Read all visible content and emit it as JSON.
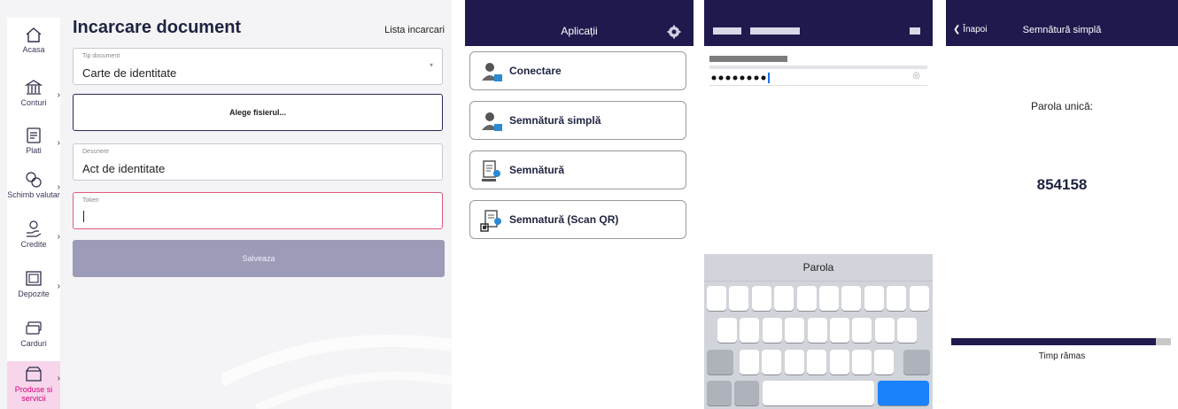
{
  "web": {
    "title": "Incarcare document",
    "link": "Lista incarcari",
    "nav": [
      {
        "label": "Acasa",
        "icon": "home-icon"
      },
      {
        "label": "Conturi",
        "icon": "bank-icon"
      },
      {
        "label": "Plati",
        "icon": "payments-icon"
      },
      {
        "label": "Schimb valutar",
        "icon": "currency-exchange-icon"
      },
      {
        "label": "Credite",
        "icon": "credit-icon"
      },
      {
        "label": "Depozite",
        "icon": "deposit-icon"
      },
      {
        "label": "Carduri",
        "icon": "cards-icon"
      },
      {
        "label": "Produse si servicii",
        "icon": "products-icon"
      }
    ],
    "doc_type_label": "Tip document",
    "doc_type_value": "Carte de identitate",
    "choose_file": "Alege fisierul...",
    "description_label": "Descriere",
    "description_value": "Act de identitate",
    "token_label": "Token",
    "save": "Salveaza",
    "accent_color": "#d6007a"
  },
  "apps": {
    "title": "Aplicații",
    "items": [
      {
        "label": "Conectare",
        "icon": "user-key-icon"
      },
      {
        "label": "Semnătură simplă",
        "icon": "user-key-icon"
      },
      {
        "label": "Semnătură",
        "icon": "document-signature-icon"
      },
      {
        "label": "Semnatură (Scan QR)",
        "icon": "qr-signature-icon"
      }
    ]
  },
  "password": {
    "keyboard_suggestion": "Parola"
  },
  "otp": {
    "back": "Înapoi",
    "title": "Semnătură simplă",
    "label": "Parola unică:",
    "code": "854158",
    "time_label": "Timp rămas",
    "progress_fraction": 0.93,
    "bar_color": "#1e1a4d"
  }
}
